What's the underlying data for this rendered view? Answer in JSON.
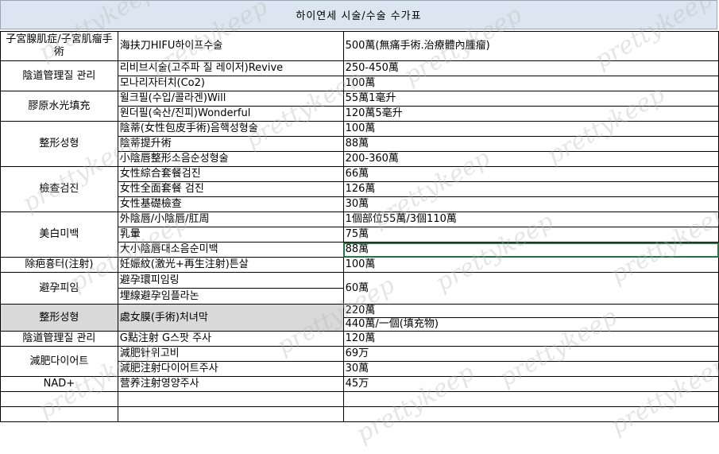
{
  "title": "하이연세 시술/수술 수가표",
  "watermark": "prettykeep",
  "rows": [
    {
      "cat": "子宮腺肌症/子宮肌瘤手術",
      "proc": "海扶刀HIFU하이프수술",
      "price": "500萬(無痛手術.治療體內腫瘤)"
    },
    {
      "cat": "陰道管理질 관리",
      "proc": "리비브시술(고주파 질 레이저)Revive",
      "price": "250-450萬"
    },
    {
      "cat": "",
      "proc": "모나리자터치(Co2)",
      "price": "100萬"
    },
    {
      "cat": "膠原水光填充",
      "proc": "윌크필(수입/콜라겐)Will",
      "price": "55萬1毫升"
    },
    {
      "cat": "",
      "proc": "원더필(숙산/진피)Wonderful",
      "price": "120萬5毫升"
    },
    {
      "cat": "整形성형",
      "proc": "陰蒂(女性包皮手術)음핵성형술",
      "price": "100萬"
    },
    {
      "cat": "",
      "proc": "陰蒂提升術",
      "price": "88萬"
    },
    {
      "cat": "",
      "proc": "小陰唇整形소음순성형술",
      "price": "200-360萬"
    },
    {
      "cat": "檢查검진",
      "proc": "女性綜合套餐검진",
      "price": "66萬"
    },
    {
      "cat": "",
      "proc": "女性全面套餐 검진",
      "price": "126萬"
    },
    {
      "cat": "",
      "proc": "女性基礎檢查",
      "price": "30萬"
    },
    {
      "cat": "美白미백",
      "proc": "外陰唇/小陰唇/肛周",
      "price": "1個部位55萬/3個110萬"
    },
    {
      "cat": "",
      "proc": "乳暈",
      "price": "75萬"
    },
    {
      "cat": "",
      "proc": "大小陰唇대소음순미백",
      "price": "88萬"
    },
    {
      "cat": "除疤흉터(注射)",
      "proc": "妊娠紋(激光+再生注射)튼살",
      "price": "100萬"
    },
    {
      "cat": "避孕피임",
      "proc": "避孕環피임링",
      "price": "60萬"
    },
    {
      "cat": "",
      "proc": "埋線避孕임플라논",
      "price": ""
    },
    {
      "cat": "整形성형",
      "proc": "處女膜(手術)처녀막",
      "price": "220萬"
    },
    {
      "cat": "",
      "proc": "",
      "price": "440萬/一個(填充物)"
    },
    {
      "cat": "陰道管理질 관리",
      "proc": "G點注射 G스팟 주사",
      "price": "120萬"
    },
    {
      "cat": "減肥다이어트",
      "proc": "減肥针위고비",
      "price": "69万"
    },
    {
      "cat": "",
      "proc": "減肥注射다이어트주사",
      "price": "30萬"
    },
    {
      "cat": "NAD+",
      "proc": "营养注射영양주사",
      "price": "45万"
    }
  ]
}
